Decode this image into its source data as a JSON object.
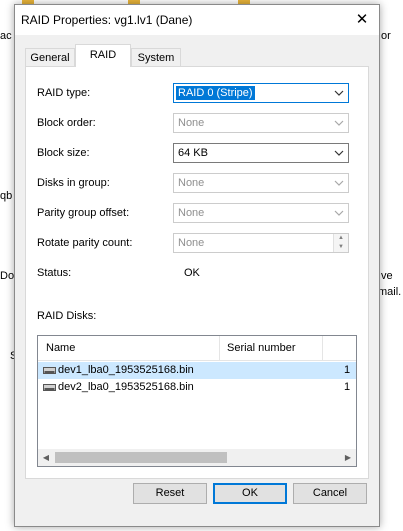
{
  "background": {
    "fragments": [
      "ac",
      "or",
      "qb",
      "Do",
      "ve",
      "mail.",
      "S"
    ]
  },
  "dialog": {
    "title": "RAID Properties: vg1.lv1 (Dane)",
    "close_glyph": "✕",
    "tabs": [
      {
        "label": "General",
        "active": false
      },
      {
        "label": "RAID",
        "active": true
      },
      {
        "label": "System",
        "active": false
      }
    ],
    "fields": {
      "raid_type": {
        "label": "RAID type:",
        "value": "RAID 0 (Stripe)"
      },
      "block_order": {
        "label": "Block order:",
        "value": "None"
      },
      "block_size": {
        "label": "Block size:",
        "value": "64 KB"
      },
      "disks_in_group": {
        "label": "Disks in group:",
        "value": "None"
      },
      "parity_group_offset": {
        "label": "Parity group offset:",
        "value": "None"
      },
      "rotate_parity_count": {
        "label": "Rotate parity count:",
        "value": "None"
      },
      "status": {
        "label": "Status:",
        "value": "OK"
      }
    },
    "raid_disks": {
      "label": "RAID Disks:",
      "columns": [
        "Name",
        "Serial number"
      ],
      "rows": [
        {
          "name": "dev1_lba0_1953525168.bin",
          "serial": "1",
          "selected": true
        },
        {
          "name": "dev2_lba0_1953525168.bin",
          "serial": "1",
          "selected": false
        }
      ]
    },
    "buttons": {
      "reset": "Reset",
      "ok": "OK",
      "cancel": "Cancel"
    }
  },
  "colors": {
    "accent": "#0078d7",
    "selection": "#cce8ff",
    "dialog_bg": "#f0f0f0"
  }
}
